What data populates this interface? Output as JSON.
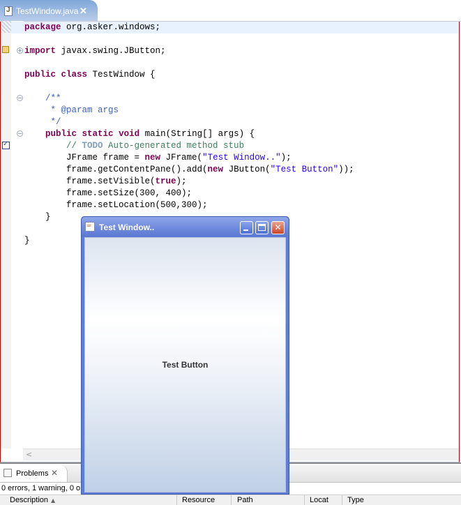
{
  "editor": {
    "tab": {
      "title": "TestWindow.java",
      "close_glyph": "✕"
    },
    "lines": [
      {
        "segments": [
          {
            "t": "package",
            "c": "kw"
          },
          {
            "t": " org.asker.windows;",
            "c": ""
          }
        ]
      },
      {
        "segments": [
          {
            "t": "",
            "c": ""
          }
        ]
      },
      {
        "segments": [
          {
            "t": "import",
            "c": "kw"
          },
          {
            "t": " javax.swing.JButton;",
            "c": ""
          }
        ]
      },
      {
        "segments": [
          {
            "t": "",
            "c": ""
          }
        ]
      },
      {
        "segments": [
          {
            "t": "public",
            "c": "kw"
          },
          {
            "t": " ",
            "c": ""
          },
          {
            "t": "class",
            "c": "kw"
          },
          {
            "t": " TestWindow {",
            "c": ""
          }
        ]
      },
      {
        "segments": [
          {
            "t": "",
            "c": ""
          }
        ]
      },
      {
        "segments": [
          {
            "t": "    /**",
            "c": "jd"
          }
        ]
      },
      {
        "segments": [
          {
            "t": "     * @param args",
            "c": "jd"
          }
        ]
      },
      {
        "segments": [
          {
            "t": "     */",
            "c": "jd"
          }
        ]
      },
      {
        "segments": [
          {
            "t": "    ",
            "c": ""
          },
          {
            "t": "public",
            "c": "kw"
          },
          {
            "t": " ",
            "c": ""
          },
          {
            "t": "static",
            "c": "kw"
          },
          {
            "t": " ",
            "c": ""
          },
          {
            "t": "void",
            "c": "kw"
          },
          {
            "t": " main(String[] args) {",
            "c": ""
          }
        ]
      },
      {
        "segments": [
          {
            "t": "        // ",
            "c": "cm"
          },
          {
            "t": "TODO",
            "c": "todo"
          },
          {
            "t": " Auto-generated method stub",
            "c": "cm"
          }
        ]
      },
      {
        "segments": [
          {
            "t": "        JFrame frame = ",
            "c": ""
          },
          {
            "t": "new",
            "c": "kw"
          },
          {
            "t": " JFrame(",
            "c": ""
          },
          {
            "t": "\"Test Window..\"",
            "c": "str"
          },
          {
            "t": ");",
            "c": ""
          }
        ]
      },
      {
        "segments": [
          {
            "t": "        frame.getContentPane().add(",
            "c": ""
          },
          {
            "t": "new",
            "c": "kw"
          },
          {
            "t": " JButton(",
            "c": ""
          },
          {
            "t": "\"Test Button\"",
            "c": "str"
          },
          {
            "t": "));",
            "c": ""
          }
        ]
      },
      {
        "segments": [
          {
            "t": "        frame.setVisible(",
            "c": ""
          },
          {
            "t": "true",
            "c": "kw"
          },
          {
            "t": ");",
            "c": ""
          }
        ]
      },
      {
        "segments": [
          {
            "t": "        frame.setSize(300, 400);",
            "c": ""
          }
        ]
      },
      {
        "segments": [
          {
            "t": "        frame.setLocation(500,300);",
            "c": ""
          }
        ]
      },
      {
        "segments": [
          {
            "t": "    }",
            "c": ""
          }
        ]
      },
      {
        "segments": [
          {
            "t": "",
            "c": ""
          }
        ]
      },
      {
        "segments": [
          {
            "t": "}",
            "c": ""
          }
        ]
      }
    ]
  },
  "problems": {
    "tab_label": "Problems",
    "close_glyph": "✕",
    "status": "0 errors, 1 warning, 0 o",
    "columns": [
      "Description",
      "Resource",
      "Path",
      "Locat",
      "Type"
    ]
  },
  "swing_window": {
    "title": "Test Window..",
    "button_label": "Test Button",
    "close_glyph": "✕"
  }
}
